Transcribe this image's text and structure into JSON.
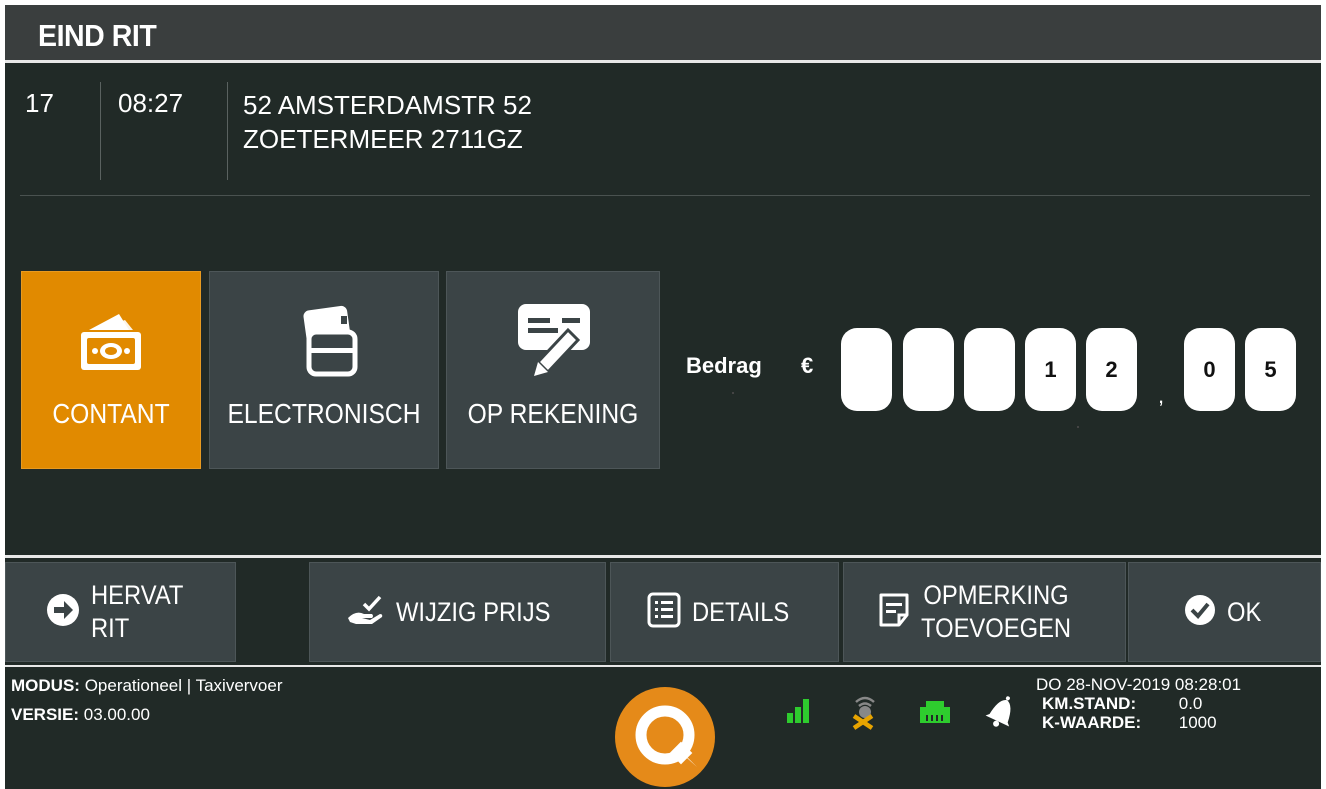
{
  "header": {
    "title": "EIND RIT"
  },
  "ride": {
    "number": "17",
    "time": "08:27",
    "address_line1": "52 AMSTERDAMSTR 52",
    "address_line2": "ZOETERMEER 2711GZ"
  },
  "payment": {
    "selected": "contant",
    "options": [
      {
        "label": "CONTANT",
        "icon": "cash-icon"
      },
      {
        "label": "ELECTRONISCH",
        "icon": "card-icon"
      },
      {
        "label": "OP REKENING",
        "icon": "invoice-sign-icon"
      }
    ]
  },
  "amount": {
    "label": "Bedrag",
    "currency": "€",
    "digits": [
      "",
      "",
      "",
      "1",
      "2"
    ],
    "decimal_separator": ",",
    "decimals": [
      "0",
      "5"
    ]
  },
  "actions": {
    "resume": {
      "line1": "HERVAT",
      "line2": "RIT",
      "icon": "arrow-right-circle-icon"
    },
    "change_price": {
      "label": "WIJZIG PRIJS",
      "icon": "hand-check-icon"
    },
    "details": {
      "label": "DETAILS",
      "icon": "list-icon"
    },
    "remark": {
      "line1": "OPMERKING",
      "line2": "TOEVOEGEN",
      "icon": "note-icon"
    },
    "ok": {
      "label": "OK",
      "icon": "check-circle-icon"
    }
  },
  "status": {
    "modus_label": "MODUS:",
    "modus_value": "Operationeel | Taxivervoer",
    "versie_label": "VERSIE:",
    "versie_value": "03.00.00",
    "datetime": "DO 28-NOV-2019 08:28:01",
    "km_label": "KM.STAND:",
    "km_value": "0.0",
    "k_label": "K-WAARDE:",
    "k_value": "1000",
    "icons": [
      "signal-icon",
      "gps-disabled-icon",
      "network-icon",
      "bell-icon"
    ]
  },
  "colors": {
    "accent": "#e18a00",
    "background": "#212a27",
    "tile": "#3b4446",
    "signal_green": "#2ecc2e"
  }
}
